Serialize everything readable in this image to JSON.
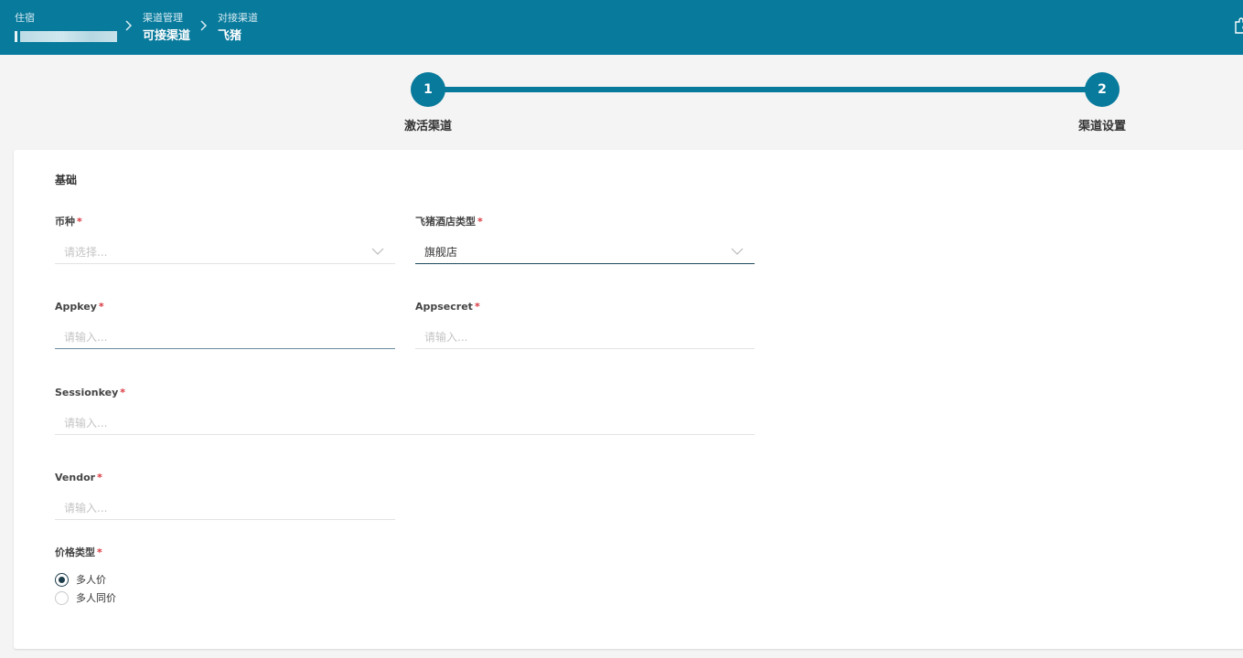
{
  "header": {
    "crumbs": [
      {
        "small": "住宿",
        "big": ""
      },
      {
        "small": "渠道管理",
        "big": "可接渠道"
      },
      {
        "small": "对接渠道",
        "big": "飞猪"
      }
    ]
  },
  "stepper": {
    "steps": [
      {
        "number": "1",
        "label": "激活渠道"
      },
      {
        "number": "2",
        "label": "渠道设置"
      }
    ]
  },
  "form": {
    "section_title": "基础",
    "required_mark": "*",
    "currency": {
      "label": "币种",
      "placeholder": "请选择..."
    },
    "hotel_type": {
      "label": "飞猪酒店类型",
      "value": "旗舰店"
    },
    "appkey": {
      "label": "Appkey",
      "placeholder": "请输入..."
    },
    "appsecret": {
      "label": "Appsecret",
      "placeholder": "请输入..."
    },
    "sessionkey": {
      "label": "Sessionkey",
      "placeholder": "请输入..."
    },
    "vendor": {
      "label": "Vendor",
      "placeholder": "请输入..."
    },
    "price_type": {
      "label": "价格类型",
      "options": [
        {
          "label": "多人价",
          "checked": true
        },
        {
          "label": "多人同价",
          "checked": false
        }
      ]
    }
  },
  "colors": {
    "header_bg": "#087a9c",
    "accent": "#087a9c",
    "required": "#d9363e"
  }
}
